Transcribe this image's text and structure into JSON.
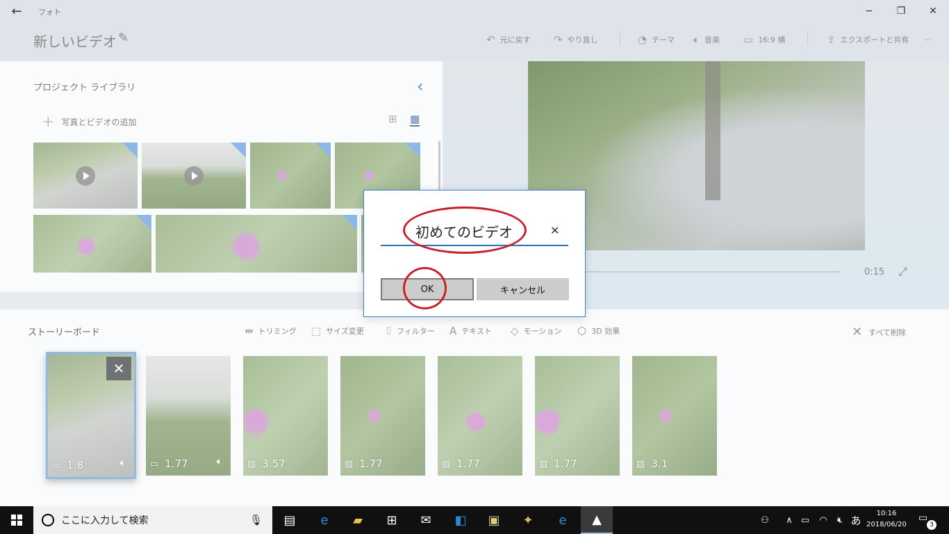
{
  "window": {
    "app_title": "フォト",
    "back_icon": "back-arrow-icon",
    "controls": [
      "minimize-icon",
      "restore-icon",
      "close-icon"
    ]
  },
  "header": {
    "project_title": "新しいビデオ",
    "toolbar": {
      "undo": "元に戻す",
      "redo": "やり直し",
      "theme": "テーマ",
      "music": "音楽",
      "aspect": "16:9 横",
      "export": "エクスポートと共有",
      "more": "···"
    }
  },
  "library": {
    "title": "プロジェクト ライブラリ",
    "add_label": "写真とビデオの追加"
  },
  "preview": {
    "time": "0:15"
  },
  "storyboard": {
    "title": "ストーリーボード",
    "tools": {
      "trim": "トリミング",
      "resize": "サイズ変更",
      "filter": "フィルター",
      "text": "テキスト",
      "motion": "モーション",
      "effects3d": "3D 効果"
    },
    "delete_all": "すべて削除",
    "cards": [
      {
        "duration": "1.8",
        "type": "video"
      },
      {
        "duration": "1.77",
        "type": "video"
      },
      {
        "duration": "3.57",
        "type": "photo"
      },
      {
        "duration": "1.77",
        "type": "photo"
      },
      {
        "duration": "1.77",
        "type": "photo"
      },
      {
        "duration": "1.77",
        "type": "photo"
      },
      {
        "duration": "3.1",
        "type": "photo"
      }
    ]
  },
  "dialog": {
    "name_value": "初めてのビデオ",
    "ok_label": "OK",
    "cancel_label": "キャンセル",
    "annotation_color": "#c8202a"
  },
  "taskbar": {
    "search_placeholder": "ここに入力して検索",
    "clock_time": "10:16",
    "clock_date": "2018/06/20",
    "ime": "あ",
    "notification_count": "3"
  }
}
